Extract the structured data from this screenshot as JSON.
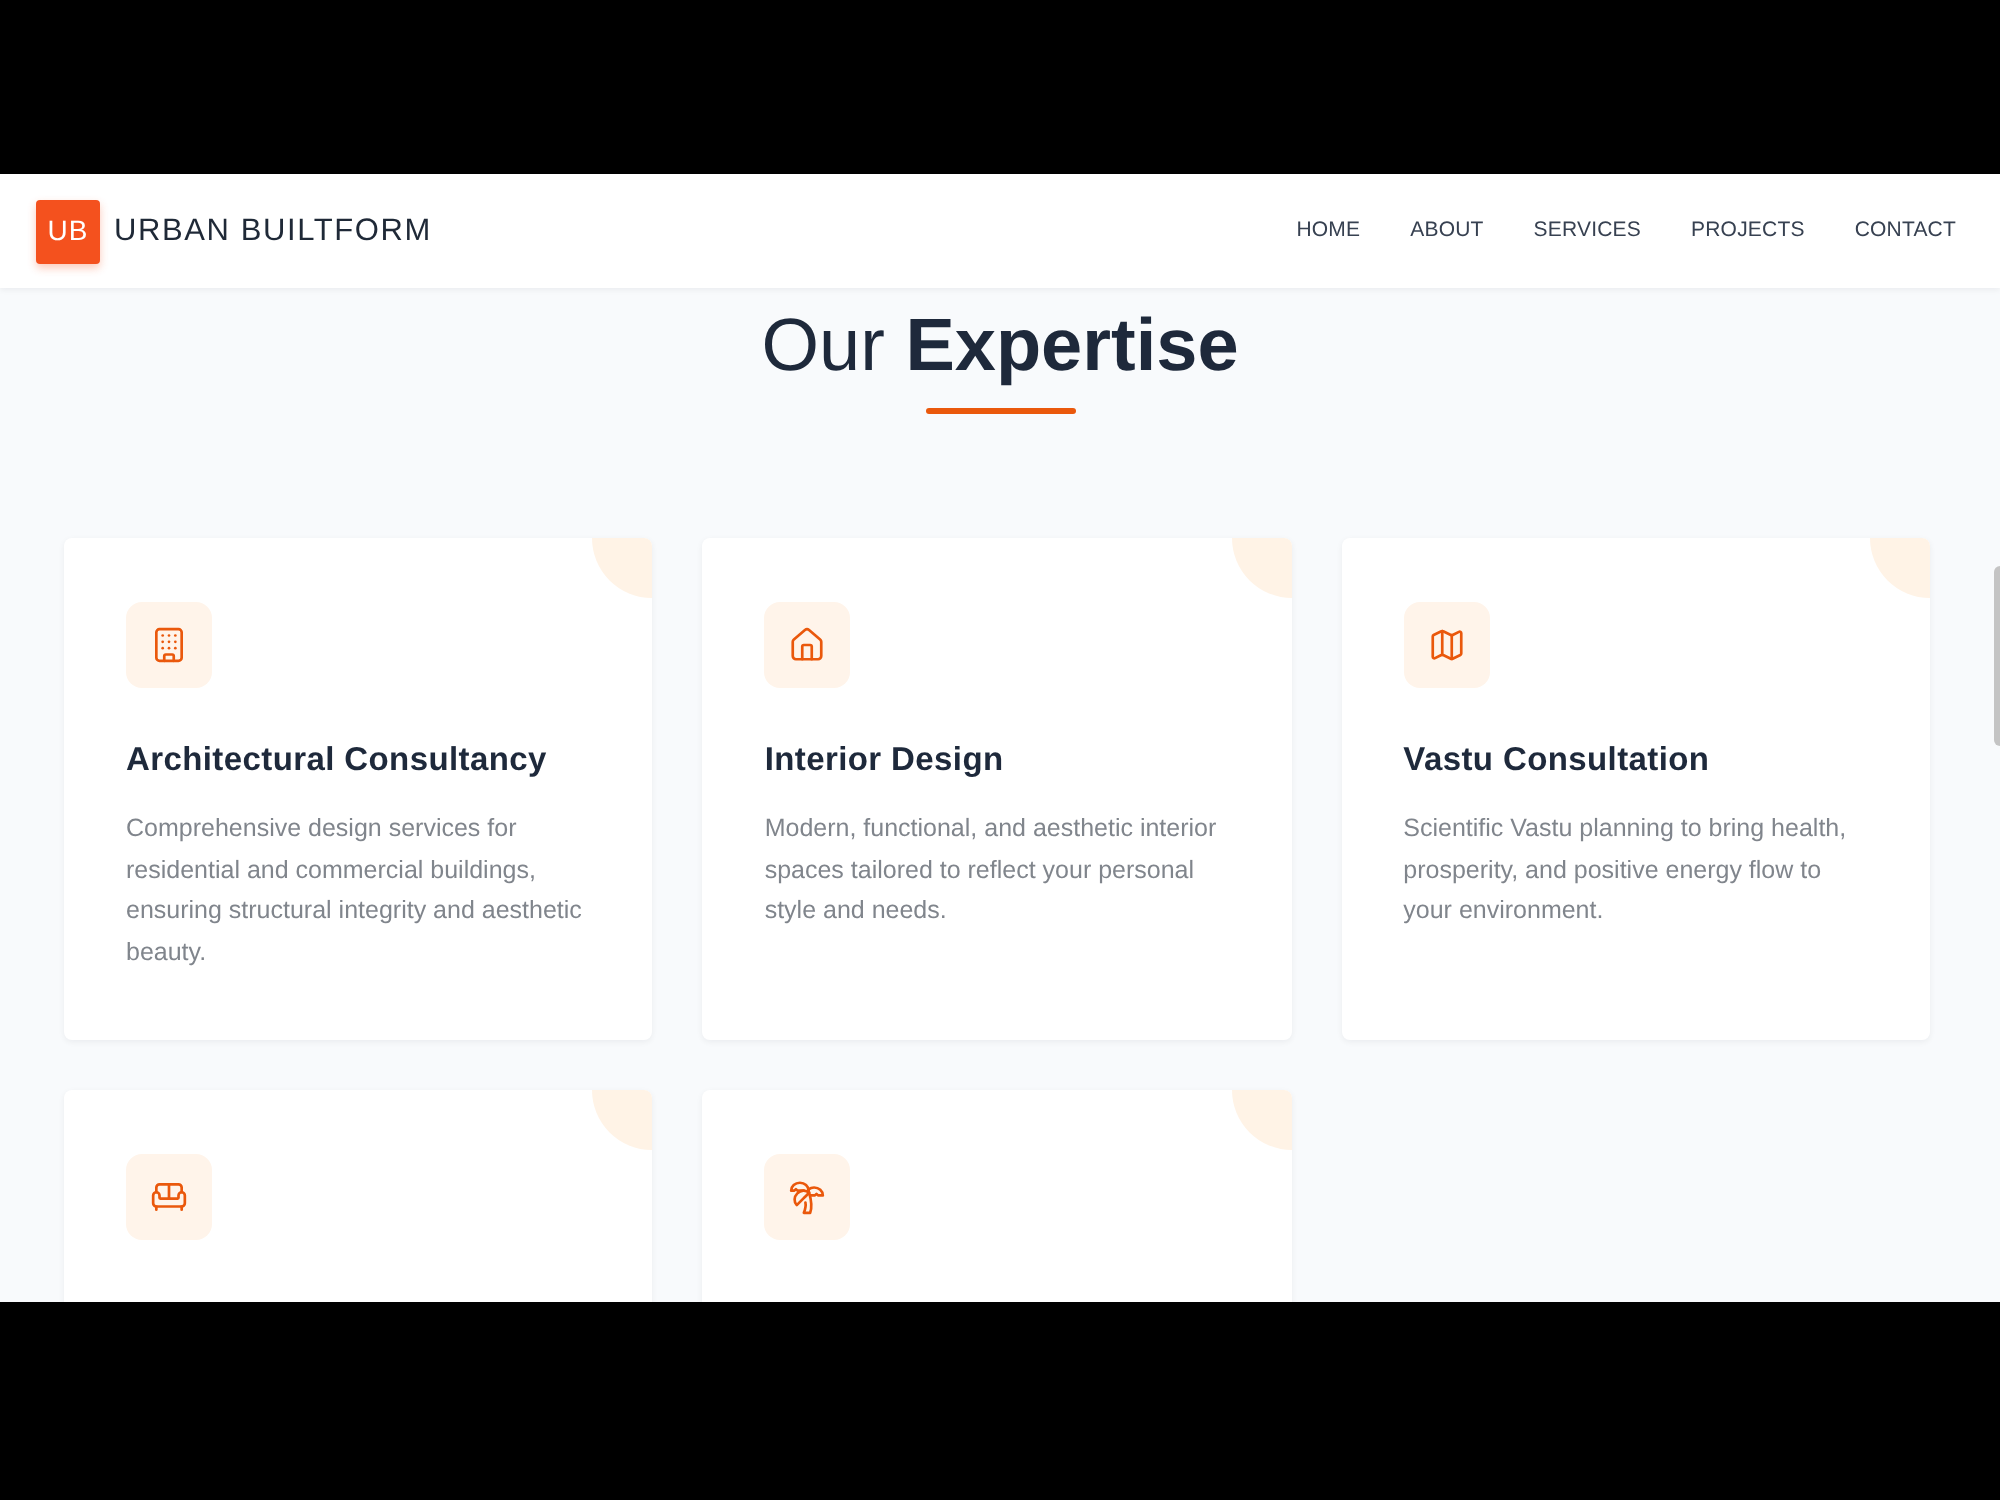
{
  "header": {
    "logo_mark": "UB",
    "brand": "URBAN BUILTFORM",
    "nav": [
      "HOME",
      "ABOUT",
      "SERVICES",
      "PROJECTS",
      "CONTACT"
    ]
  },
  "section": {
    "title": "Our **Expertise**"
  },
  "cards": [
    {
      "kind": "full",
      "title": "Architectural Consultancy",
      "description": "Comprehensive design services for residential and commercial buildings, ensuring structural integrity and aesthetic beauty."
    },
    {
      "kind": "full",
      "title": "Interior Design",
      "description": "Modern, functional, and aesthetic interior spaces tailored to reflect your personal style and needs."
    },
    {
      "kind": "full",
      "title": "Vastu Consultation",
      "description": "Scientific Vastu planning to bring health, prosperity, and positive energy flow to your environment."
    },
    {
      "kind": "cut_off"
    },
    {
      "kind": "cut_off"
    }
  ]
}
